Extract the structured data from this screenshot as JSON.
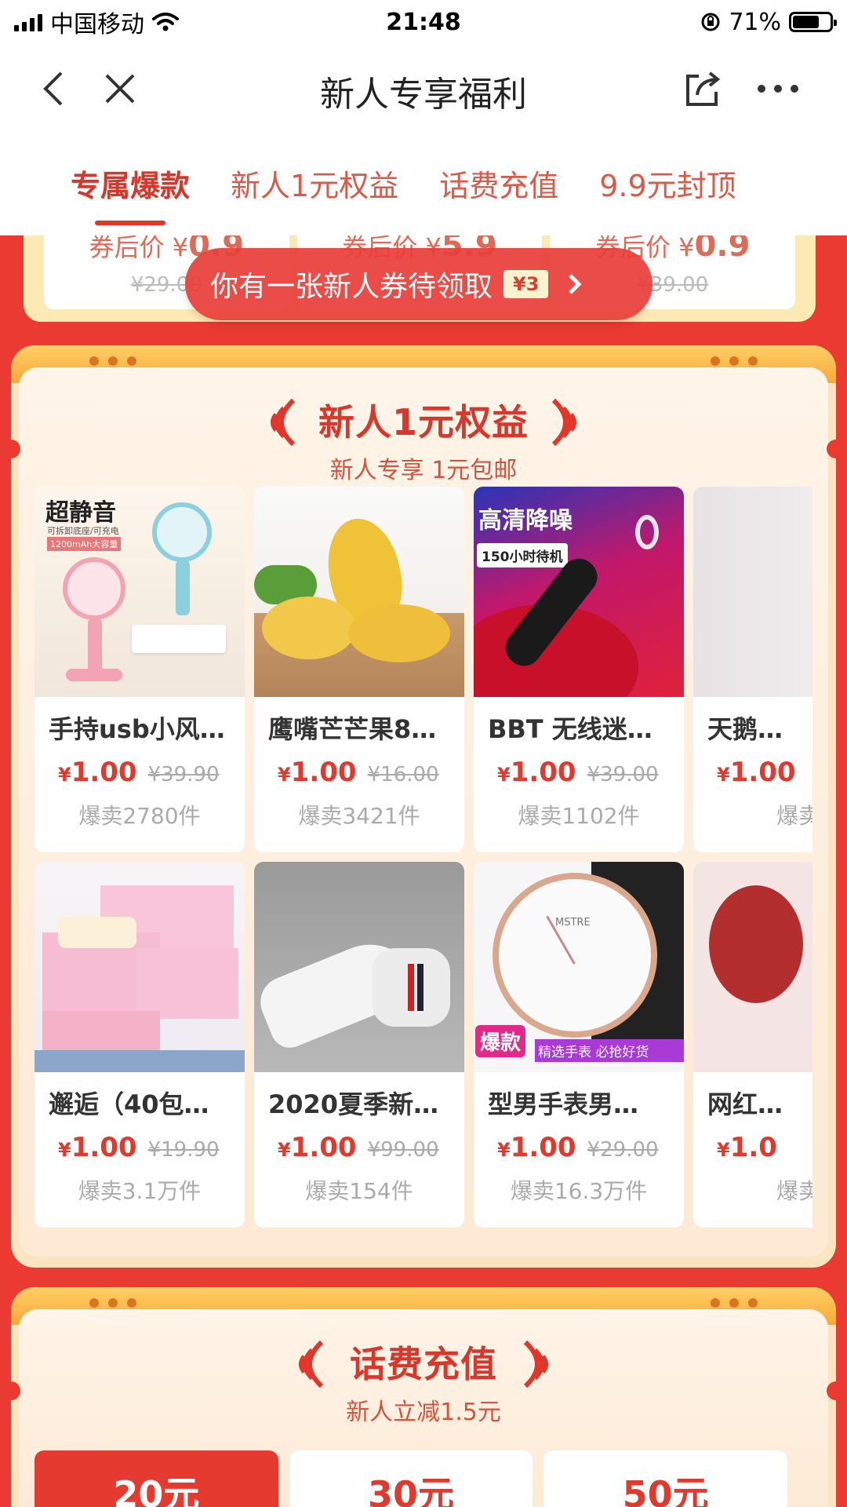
{
  "status_bar": {
    "carrier": "中国移动",
    "time": "21:48",
    "battery_percent": "71%",
    "battery_level": 0.71
  },
  "nav": {
    "title": "新人专享福利"
  },
  "tabs": [
    {
      "label": "专属爆款",
      "active": true
    },
    {
      "label": "新人1元权益",
      "active": false
    },
    {
      "label": "话费充值",
      "active": false
    },
    {
      "label": "9.9元封顶",
      "active": false
    }
  ],
  "top_cards": [
    {
      "price_label": "券后价 ¥",
      "price": "0.9",
      "original": "¥29.00"
    },
    {
      "price_label": "券后价 ¥",
      "price": "5.9",
      "original": ""
    },
    {
      "price_label": "券后价 ¥",
      "price": "0.9",
      "original": "¥39.00"
    }
  ],
  "toast": {
    "text": "你有一张新人券待领取",
    "coupon": "¥3"
  },
  "section1": {
    "title": "新人1元权益",
    "subtitle": "新人专享 1元包邮",
    "rows": [
      [
        {
          "name": "手持usb小风…",
          "currency": "¥",
          "price": "1.00",
          "original": "¥39.90",
          "sold": "爆卖2780件",
          "img_text": "超静音",
          "img_sub": "可拆卸底座/可充电",
          "img_tag": "1200mAh大容量"
        },
        {
          "name": "鹰嘴芒芒果8…",
          "currency": "¥",
          "price": "1.00",
          "original": "¥16.00",
          "sold": "爆卖3421件"
        },
        {
          "name": "BBT 无线迷…",
          "currency": "¥",
          "price": "1.00",
          "original": "¥39.00",
          "sold": "爆卖1102件",
          "img_text": "高清降噪",
          "img_tag": "150小时待机"
        },
        {
          "name": "天鹅…",
          "currency": "¥",
          "price": "1.00",
          "original": "",
          "sold": "爆卖"
        }
      ],
      [
        {
          "name": "邂逅（40包…",
          "currency": "¥",
          "price": "1.00",
          "original": "¥19.90",
          "sold": "爆卖3.1万件"
        },
        {
          "name": "2020夏季新…",
          "currency": "¥",
          "price": "1.00",
          "original": "¥99.00",
          "sold": "爆卖154件"
        },
        {
          "name": "型男手表男…",
          "currency": "¥",
          "price": "1.00",
          "original": "¥29.00",
          "sold": "爆卖16.3万件",
          "img_badge": "爆款",
          "img_banner": "精选手表 必抢好货",
          "watch_brand": "MSTRE"
        },
        {
          "name": "网红…",
          "currency": "¥",
          "price": "1.0",
          "original": "",
          "sold": "爆卖"
        }
      ]
    ]
  },
  "section2": {
    "title": "话费充值",
    "subtitle": "新人立减1.5元",
    "tiles": [
      {
        "label": "20元",
        "active": true
      },
      {
        "label": "30元",
        "active": false
      },
      {
        "label": "50元",
        "active": false
      }
    ]
  },
  "colors": {
    "page_bg": "#ea3a32",
    "accent": "#e03a2e",
    "panel": "#fbe5c0"
  }
}
